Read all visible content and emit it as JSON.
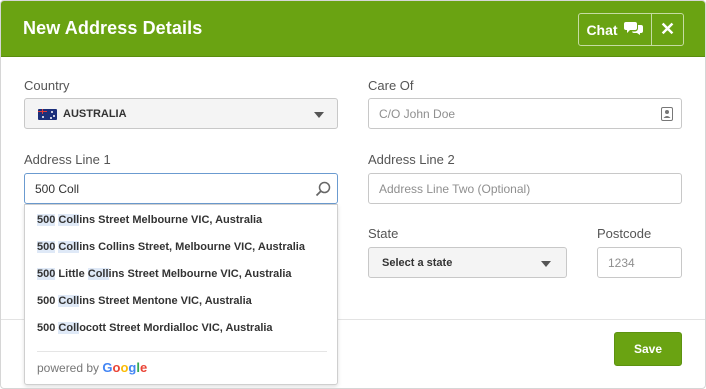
{
  "header": {
    "title": "New Address Details",
    "chat_label": "Chat",
    "close_symbol": "✕",
    "background_color": "#6aa312"
  },
  "form": {
    "country": {
      "label": "Country",
      "value": "AUSTRALIA",
      "flag_icon": "australia-flag-icon"
    },
    "care_of": {
      "label": "Care Of",
      "placeholder": "C/O John Doe"
    },
    "address_line_1": {
      "label": "Address Line 1",
      "value": "500 Coll"
    },
    "address_line_2": {
      "label": "Address Line 2",
      "placeholder": "Address Line Two (Optional)"
    },
    "state": {
      "label": "State",
      "placeholder": "Select a state"
    },
    "postcode": {
      "label": "Postcode",
      "placeholder": "1234"
    }
  },
  "autocomplete": {
    "suggestions": [
      {
        "parts": [
          [
            "500",
            true
          ],
          [
            " ",
            false
          ],
          [
            "Coll",
            true
          ],
          [
            "ins Street Melbourne VIC, Australia",
            false
          ]
        ]
      },
      {
        "parts": [
          [
            "500",
            true
          ],
          [
            " ",
            false
          ],
          [
            "Coll",
            true
          ],
          [
            "ins Collins Street, Melbourne VIC, Australia",
            false
          ]
        ]
      },
      {
        "parts": [
          [
            "500",
            true
          ],
          [
            " Little ",
            false
          ],
          [
            "Coll",
            true
          ],
          [
            "ins Street Melbourne VIC, Australia",
            false
          ]
        ]
      },
      {
        "parts": [
          [
            "500",
            false
          ],
          [
            " ",
            false
          ],
          [
            "Coll",
            true
          ],
          [
            "ins Street Mentone VIC, Australia",
            false
          ]
        ]
      },
      {
        "parts": [
          [
            "500",
            false
          ],
          [
            " ",
            false
          ],
          [
            "Coll",
            true
          ],
          [
            "ocott Street Mordialloc VIC, Australia",
            false
          ]
        ]
      }
    ],
    "powered_by": "powered by",
    "google_letters": [
      "G",
      "o",
      "o",
      "g",
      "l",
      "e"
    ]
  },
  "footer": {
    "save_label": "Save"
  }
}
